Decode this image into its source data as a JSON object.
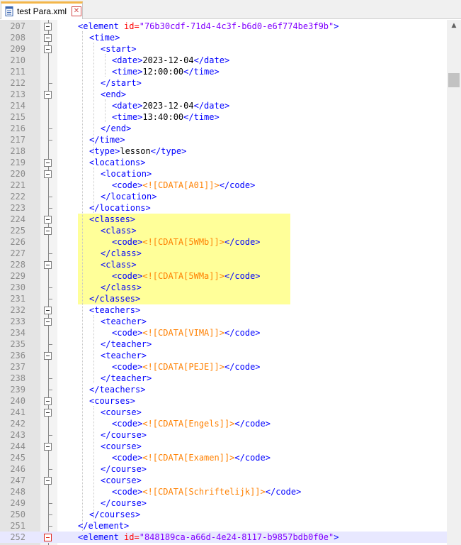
{
  "tab": {
    "title": "test Para.xml",
    "close_label": "✕"
  },
  "editor": {
    "lines": [
      {
        "num": "207",
        "fold": "box",
        "parts": [
          [
            "t",
            "<element "
          ],
          [
            "a",
            "id="
          ],
          [
            "v",
            "\"76b30cdf-71d4-4c3f-b6d0-e6f774be3f9b\""
          ],
          [
            "t",
            ">"
          ]
        ]
      },
      {
        "num": "208",
        "fold": "box",
        "parts": [
          [
            "t",
            "<time>"
          ]
        ]
      },
      {
        "num": "209",
        "fold": "box",
        "parts": [
          [
            "t",
            "<start>"
          ]
        ]
      },
      {
        "num": "210",
        "fold": "line",
        "parts": [
          [
            "t",
            "<date>"
          ],
          [
            "x",
            "2023-12-04"
          ],
          [
            "t",
            "</date>"
          ]
        ]
      },
      {
        "num": "211",
        "fold": "line",
        "parts": [
          [
            "t",
            "<time>"
          ],
          [
            "x",
            "12:00:00"
          ],
          [
            "t",
            "</time>"
          ]
        ]
      },
      {
        "num": "212",
        "fold": "tick",
        "parts": [
          [
            "t",
            "</start>"
          ]
        ]
      },
      {
        "num": "213",
        "fold": "box",
        "parts": [
          [
            "t",
            "<end>"
          ]
        ]
      },
      {
        "num": "214",
        "fold": "line",
        "parts": [
          [
            "t",
            "<date>"
          ],
          [
            "x",
            "2023-12-04"
          ],
          [
            "t",
            "</date>"
          ]
        ]
      },
      {
        "num": "215",
        "fold": "line",
        "parts": [
          [
            "t",
            "<time>"
          ],
          [
            "x",
            "13:40:00"
          ],
          [
            "t",
            "</time>"
          ]
        ]
      },
      {
        "num": "216",
        "fold": "tick",
        "parts": [
          [
            "t",
            "</end>"
          ]
        ]
      },
      {
        "num": "217",
        "fold": "tick",
        "parts": [
          [
            "t",
            "</time>"
          ]
        ]
      },
      {
        "num": "218",
        "fold": "line",
        "parts": [
          [
            "t",
            "<type>"
          ],
          [
            "x",
            "lesson"
          ],
          [
            "t",
            "</type>"
          ]
        ]
      },
      {
        "num": "219",
        "fold": "box",
        "parts": [
          [
            "t",
            "<locations>"
          ]
        ]
      },
      {
        "num": "220",
        "fold": "box",
        "parts": [
          [
            "t",
            "<location>"
          ]
        ]
      },
      {
        "num": "221",
        "fold": "line",
        "parts": [
          [
            "t",
            "<code>"
          ],
          [
            "c",
            "<![CDATA[A01]]>"
          ],
          [
            "t",
            "</code>"
          ]
        ]
      },
      {
        "num": "222",
        "fold": "tick",
        "parts": [
          [
            "t",
            "</location>"
          ]
        ]
      },
      {
        "num": "223",
        "fold": "tick",
        "parts": [
          [
            "t",
            "</locations>"
          ]
        ]
      },
      {
        "num": "224",
        "fold": "box",
        "parts": [
          [
            "t",
            "<classes>"
          ]
        ]
      },
      {
        "num": "225",
        "fold": "box",
        "parts": [
          [
            "t",
            "<class>"
          ]
        ]
      },
      {
        "num": "226",
        "fold": "line",
        "parts": [
          [
            "t",
            "<code>"
          ],
          [
            "c",
            "<![CDATA[5WMb]]>"
          ],
          [
            "t",
            "</code>"
          ]
        ]
      },
      {
        "num": "227",
        "fold": "tick",
        "parts": [
          [
            "t",
            "</class>"
          ]
        ]
      },
      {
        "num": "228",
        "fold": "box",
        "parts": [
          [
            "t",
            "<class>"
          ]
        ]
      },
      {
        "num": "229",
        "fold": "line",
        "parts": [
          [
            "t",
            "<code>"
          ],
          [
            "c",
            "<![CDATA[5WMa]]>"
          ],
          [
            "t",
            "</code>"
          ]
        ]
      },
      {
        "num": "230",
        "fold": "tick",
        "parts": [
          [
            "t",
            "</class>"
          ]
        ]
      },
      {
        "num": "231",
        "fold": "tick",
        "parts": [
          [
            "t",
            "</classes>"
          ]
        ]
      },
      {
        "num": "232",
        "fold": "box",
        "parts": [
          [
            "t",
            "<teachers>"
          ]
        ]
      },
      {
        "num": "233",
        "fold": "box",
        "parts": [
          [
            "t",
            "<teacher>"
          ]
        ]
      },
      {
        "num": "234",
        "fold": "line",
        "parts": [
          [
            "t",
            "<code>"
          ],
          [
            "c",
            "<![CDATA[VIMA]]>"
          ],
          [
            "t",
            "</code>"
          ]
        ]
      },
      {
        "num": "235",
        "fold": "tick",
        "parts": [
          [
            "t",
            "</teacher>"
          ]
        ]
      },
      {
        "num": "236",
        "fold": "box",
        "parts": [
          [
            "t",
            "<teacher>"
          ]
        ]
      },
      {
        "num": "237",
        "fold": "line",
        "parts": [
          [
            "t",
            "<code>"
          ],
          [
            "c",
            "<![CDATA[PEJE]]>"
          ],
          [
            "t",
            "</code>"
          ]
        ]
      },
      {
        "num": "238",
        "fold": "tick",
        "parts": [
          [
            "t",
            "</teacher>"
          ]
        ]
      },
      {
        "num": "239",
        "fold": "tick",
        "parts": [
          [
            "t",
            "</teachers>"
          ]
        ]
      },
      {
        "num": "240",
        "fold": "box",
        "parts": [
          [
            "t",
            "<courses>"
          ]
        ]
      },
      {
        "num": "241",
        "fold": "box",
        "parts": [
          [
            "t",
            "<course>"
          ]
        ]
      },
      {
        "num": "242",
        "fold": "line",
        "parts": [
          [
            "t",
            "<code>"
          ],
          [
            "c",
            "<![CDATA[Engels]]>"
          ],
          [
            "t",
            "</code>"
          ]
        ]
      },
      {
        "num": "243",
        "fold": "tick",
        "parts": [
          [
            "t",
            "</course>"
          ]
        ]
      },
      {
        "num": "244",
        "fold": "box",
        "parts": [
          [
            "t",
            "<course>"
          ]
        ]
      },
      {
        "num": "245",
        "fold": "line",
        "parts": [
          [
            "t",
            "<code>"
          ],
          [
            "c",
            "<![CDATA[Examen]]>"
          ],
          [
            "t",
            "</code>"
          ]
        ]
      },
      {
        "num": "246",
        "fold": "tick",
        "parts": [
          [
            "t",
            "</course>"
          ]
        ]
      },
      {
        "num": "247",
        "fold": "box",
        "parts": [
          [
            "t",
            "<course>"
          ]
        ]
      },
      {
        "num": "248",
        "fold": "line",
        "parts": [
          [
            "t",
            "<code>"
          ],
          [
            "c",
            "<![CDATA[Schriftelijk]]>"
          ],
          [
            "t",
            "</code>"
          ]
        ]
      },
      {
        "num": "249",
        "fold": "tick",
        "parts": [
          [
            "t",
            "</course>"
          ]
        ]
      },
      {
        "num": "250",
        "fold": "tick",
        "parts": [
          [
            "t",
            "</courses>"
          ]
        ]
      },
      {
        "num": "251",
        "fold": "tick",
        "parts": [
          [
            "t",
            "</element>"
          ]
        ]
      },
      {
        "num": "252",
        "fold": "redbox",
        "parts": [
          [
            "t",
            "<element "
          ],
          [
            "a",
            "id="
          ],
          [
            "v",
            "\"848189ca-a66d-4e24-8117-b9857bdb0f0e\""
          ],
          [
            "t",
            ">"
          ]
        ]
      }
    ]
  },
  "colors": {
    "tag": "#0000ff",
    "attr": "#ff0000",
    "value": "#8000ff",
    "cdata": "#ff8000",
    "selection": "#ffff99",
    "current_line": "#e8e8ff"
  },
  "icons": {
    "file": "file-icon",
    "close": "close-icon"
  }
}
